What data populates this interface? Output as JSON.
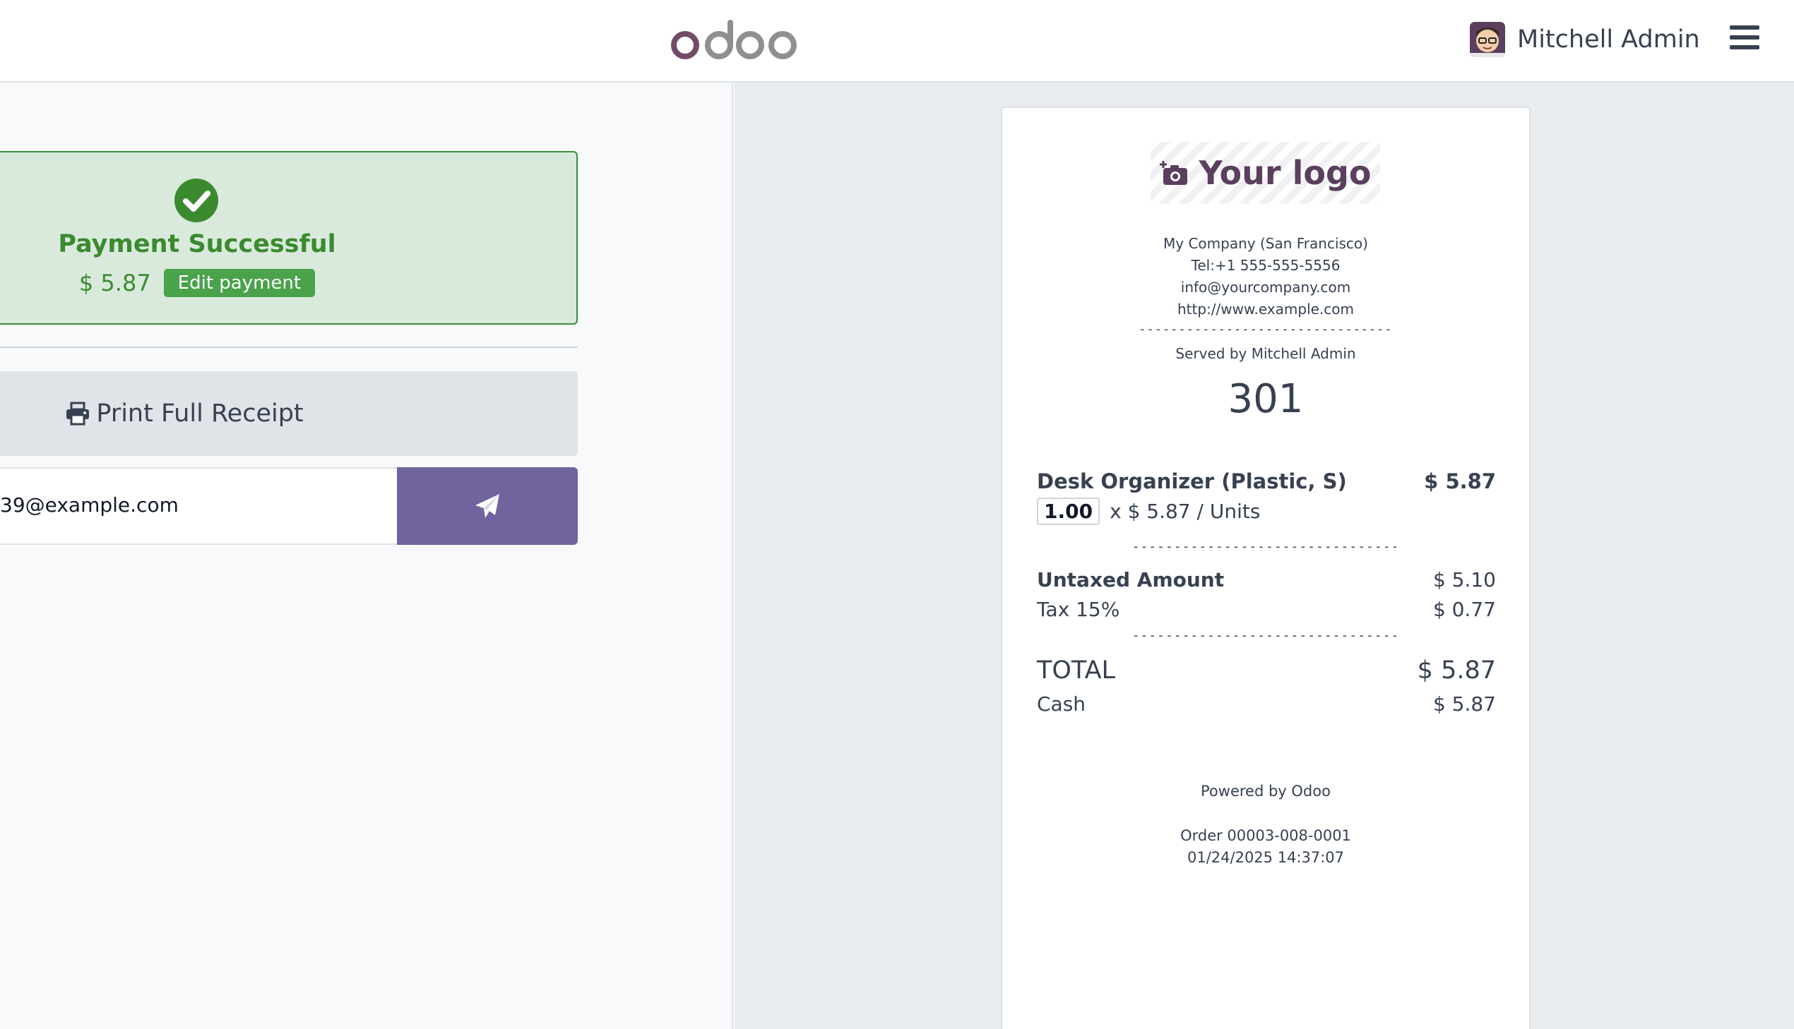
{
  "header": {
    "logo_text": "odoo",
    "user_name": "Mitchell Admin",
    "menu_icon": "hamburger-icon",
    "brand_color": "#71639e"
  },
  "payment": {
    "status_title": "Payment Successful",
    "amount": "$ 5.87",
    "edit_label": "Edit payment",
    "success_color": "#3b8a2f"
  },
  "actions": {
    "print_label": "Print Full Receipt",
    "email_value": "39@example.com",
    "send_icon": "paper-plane-icon"
  },
  "receipt": {
    "logo_text": "Your logo",
    "company_lines": [
      "My Company (San Francisco)",
      "Tel:+1 555-555-5556",
      "info@yourcompany.com",
      "http://www.example.com"
    ],
    "separator": "--------------------------------",
    "served_by": "Served by Mitchell Admin",
    "order_number": "301",
    "product": {
      "name": "Desk Organizer (Plastic, S)",
      "price": "$ 5.87",
      "qty": "1.00",
      "unit_price": "x $ 5.87 / Units"
    },
    "untaxed_label": "Untaxed Amount",
    "untaxed_value": "$ 5.10",
    "tax_label": "Tax 15%",
    "tax_value": "$ 0.77",
    "total_label": "TOTAL",
    "total_value": "$ 5.87",
    "cash_label": "Cash",
    "cash_value": "$ 5.87",
    "powered_by": "Powered by Odoo",
    "order_ref": "Order 00003-008-0001",
    "datetime": "01/24/2025 14:37:07"
  }
}
